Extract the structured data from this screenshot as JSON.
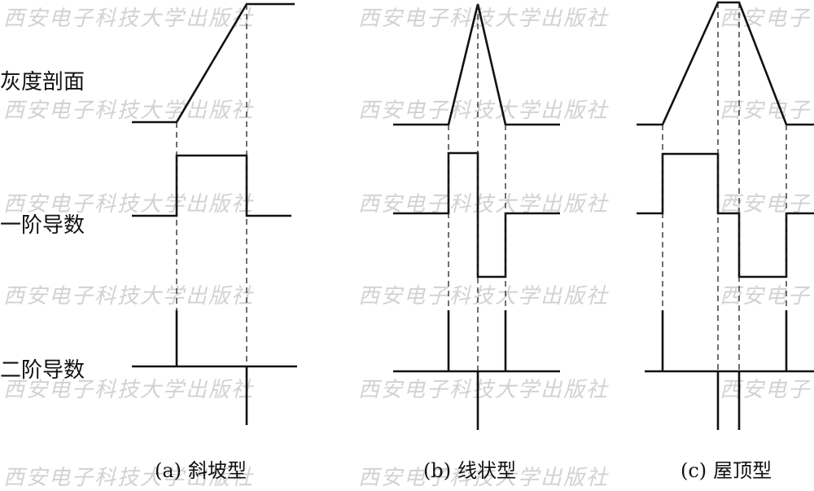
{
  "watermark": {
    "text": "西安电子科技大学出版社",
    "partial": "西安电子"
  },
  "row_labels": {
    "gray_profile": "灰度剖面",
    "first_derivative": "一阶导数",
    "second_derivative": "二阶导数"
  },
  "panels": [
    {
      "id": "a",
      "tag": "(a)",
      "name": "斜坡型"
    },
    {
      "id": "b",
      "tag": "(b)",
      "name": "线状型"
    },
    {
      "id": "c",
      "tag": "(c)",
      "name": "屋顶型"
    }
  ]
}
